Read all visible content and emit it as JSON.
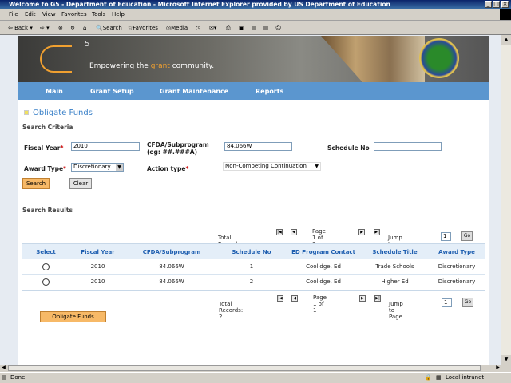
{
  "window": {
    "title": "Welcome to G5 - Department of Education - Microsoft Internet Explorer provided by US Department of Education"
  },
  "menu": [
    "File",
    "Edit",
    "View",
    "Favorites",
    "Tools",
    "Help"
  ],
  "toolbar": {
    "back": "Back",
    "search": "Search",
    "favorites": "Favorites",
    "media": "Media"
  },
  "banner": {
    "logo": "G5",
    "tagline_pre": "Empowering the ",
    "tagline_accent": "grant",
    "tagline_post": " community."
  },
  "nav": [
    "Main",
    "Grant Setup",
    "Grant Maintenance",
    "Reports"
  ],
  "page": {
    "title": "Obligate Funds",
    "criteria_heading": "Search Criteria",
    "results_heading": "Search Results"
  },
  "form": {
    "fiscal_year_label": "Fiscal Year",
    "fiscal_year": "2010",
    "cfda_label": "CFDA/Subprogram",
    "cfda_hint": "(eg: ##.###A)",
    "cfda": "84.066W",
    "schedule_label": "Schedule No",
    "schedule": "",
    "award_type_label": "Award Type",
    "award_type": "Discretionary",
    "action_type_label": "Action type",
    "action_type": "Non-Competing Continuation",
    "search": "Search",
    "clear": "Clear"
  },
  "pager": {
    "total": "Total Records: 2",
    "page": "Page 1 of 1",
    "jump": "Jump to Page",
    "jump_value": "1",
    "go": "Go"
  },
  "table": {
    "headers": [
      "Select",
      "Fiscal Year",
      "CFDA/Subprogram",
      "Schedule No",
      "ED Program Contact",
      "Schedule Title",
      "Award Type"
    ],
    "rows": [
      [
        "2010",
        "84.066W",
        "1",
        "Coolidge, Ed",
        "Trade Schools",
        "Discretionary"
      ],
      [
        "2010",
        "84.066W",
        "2",
        "Coolidge, Ed",
        "Higher Ed",
        "Discretionary"
      ]
    ]
  },
  "obligate_button": "Obligate Funds",
  "status": {
    "text": "Done",
    "zone": "Local intranet"
  },
  "colors": {
    "nav": "#5b96cf",
    "accent": "#f7b967",
    "link": "#1f5fb0"
  }
}
